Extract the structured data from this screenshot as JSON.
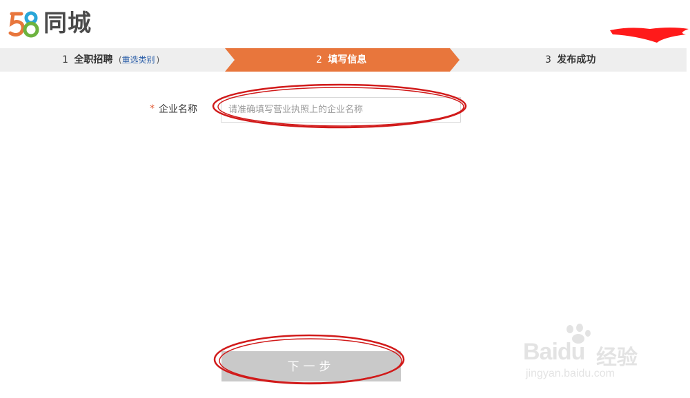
{
  "header": {
    "logo_number": "58",
    "logo_word": "同城"
  },
  "steps": [
    {
      "num": "1",
      "label": "全职招聘",
      "paren_open": "(",
      "reselect": "重选类别",
      "paren_close": ")"
    },
    {
      "num": "2",
      "label": "填写信息",
      "active": true
    },
    {
      "num": "3",
      "label": "发布成功"
    }
  ],
  "form": {
    "required_mark": "*",
    "company_label": "企业名称",
    "company_placeholder": "请准确填写营业执照上的企业名称",
    "company_value": ""
  },
  "next_button": {
    "label": "下一步"
  },
  "watermark": {
    "brand": "Baidu",
    "cn": "经验",
    "url": "jingyan.baidu.com"
  },
  "colors": {
    "active_step": "#e8763c",
    "steps_bg": "#eeeeee",
    "button_disabled": "#c9c9c9",
    "annotation": "#d11a1a",
    "required": "#e0542c"
  }
}
